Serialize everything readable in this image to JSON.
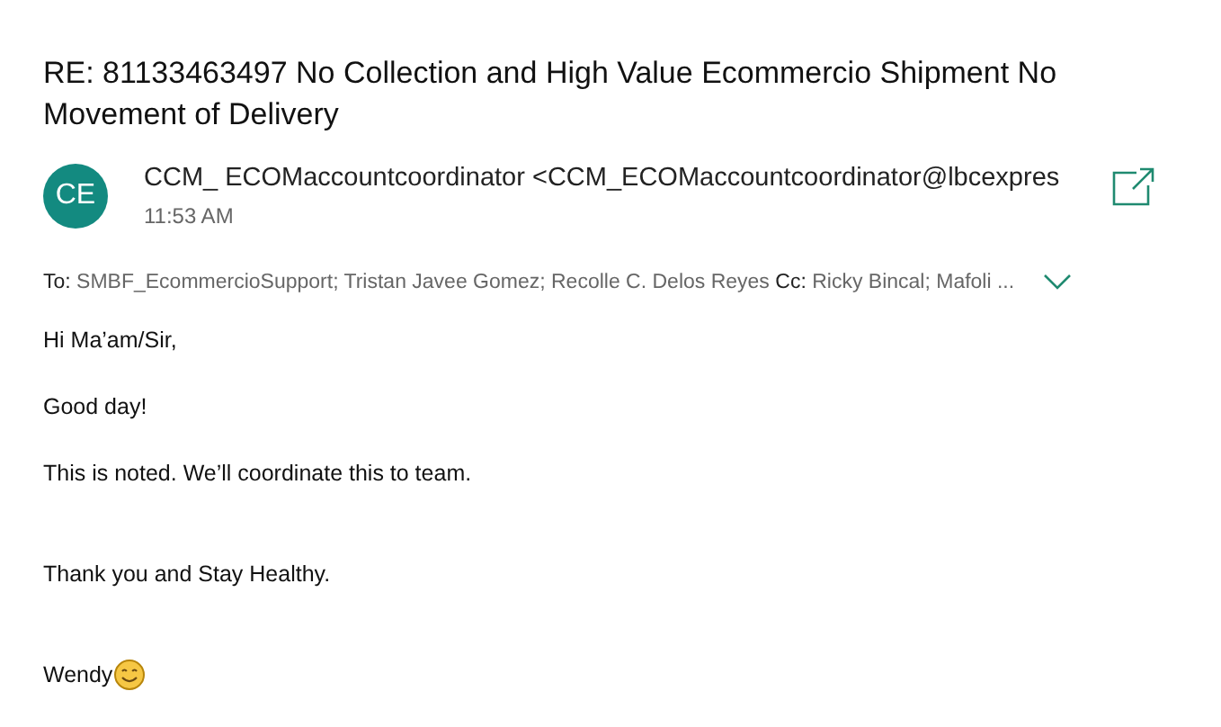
{
  "subject": "RE: 81133463497 No Collection and High Value Ecommercio Shipment No Movement of Delivery",
  "sender": {
    "initials": "CE",
    "name": "CCM_ ECOMaccountcoordinator <CCM_ECOMaccountcoordinator@lbcexpres",
    "time": "11:53 AM"
  },
  "recipients": {
    "to_label": "To:",
    "to": "SMBF_EcommercioSupport; Tristan Javee Gomez; Recolle C. Delos Reyes",
    "cc_label": "Cc:",
    "cc": "Ricky Bincal; Mafoli ...",
    "expanded": false
  },
  "body": [
    {
      "kind": "line",
      "text": "Hi Ma’am/Sir,"
    },
    {
      "kind": "line",
      "text": "Good day!"
    },
    {
      "kind": "line",
      "text": "This is noted. We’ll coordinate this to team."
    },
    {
      "kind": "line",
      "text": "Thank you and Stay Healthy."
    },
    {
      "kind": "signature",
      "text": "Wendy"
    }
  ]
}
